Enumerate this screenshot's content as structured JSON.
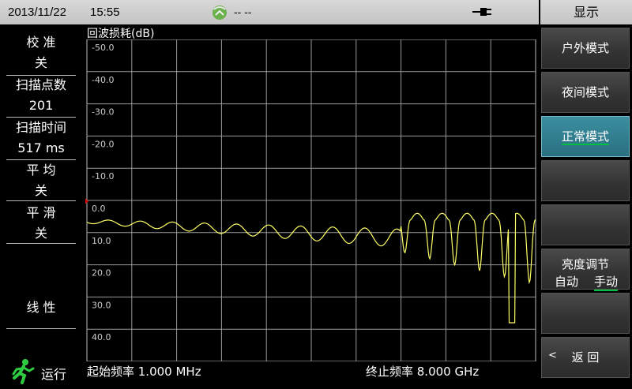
{
  "status": {
    "date": "2013/11/22",
    "time": "15:55",
    "gps_text": "-- --",
    "gps_icon": "gps-satellite-icon",
    "power_icon": "power-plug-icon"
  },
  "menu_title": "显示",
  "left_panel": {
    "calibration_label": "校 准",
    "calibration_value": "关",
    "points_label": "扫描点数",
    "points_value": "201",
    "sweep_time_label": "扫描时间",
    "sweep_time_value": "517 ms",
    "average_label": "平 均",
    "average_value": "关",
    "smooth_label": "平 滑",
    "smooth_value": "关",
    "scale_label": "线 性",
    "run_label": "运行",
    "run_icon": "running-man-icon"
  },
  "plot": {
    "title": "回波损耗(dB)",
    "start_freq": "起始频率 1.000 MHz",
    "stop_freq": "终止频率 8.000 GHz",
    "trace_color": "#ffff66",
    "grid_color": "#9a9a9a"
  },
  "chart_data": {
    "type": "line",
    "title": "回波损耗(dB)",
    "ylabel": "回波损耗(dB)",
    "ylim": [
      -50,
      50
    ],
    "y_ticks": [
      "-50.0",
      "-40.0",
      "-30.0",
      "-20.0",
      "-10.0",
      "0.0",
      "10.0",
      "20.0",
      "30.0",
      "40.0"
    ],
    "x_start": "起始频率 1.000 MHz",
    "x_stop": "终止频率 8.000 GHz",
    "grid": true,
    "reference_marker_y": 0.0
  },
  "softkeys": {
    "outdoor": "户外模式",
    "night": "夜间模式",
    "normal": "正常模式",
    "brightness": "亮度调节",
    "auto": "自动",
    "manual": "手动",
    "back": "返 回",
    "back_arrow": "<"
  }
}
